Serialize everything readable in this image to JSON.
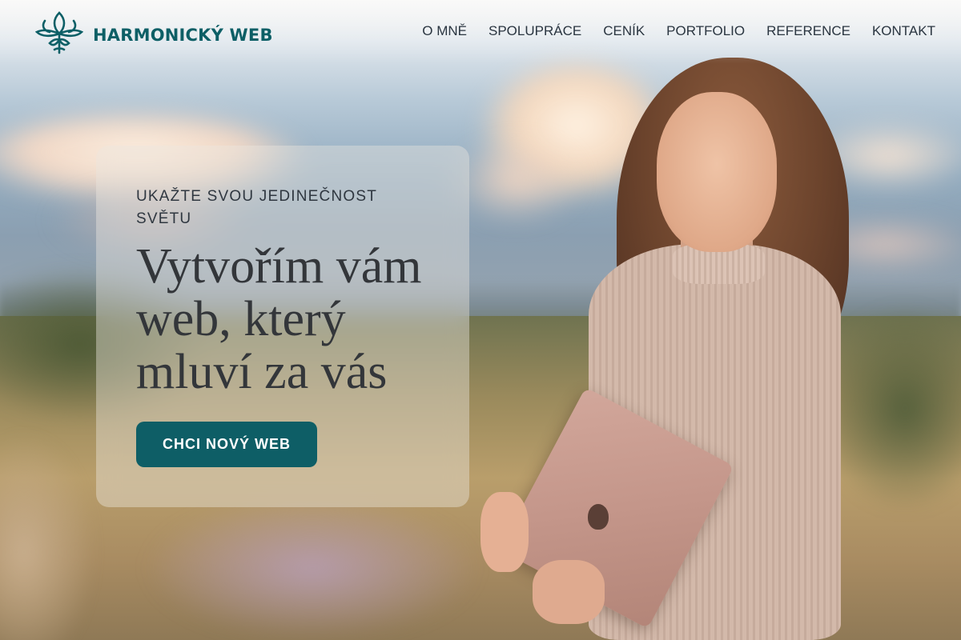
{
  "brand": {
    "name": "HARMONICKÝ WEB",
    "logo_icon": "lotus-ornament-icon",
    "color": "#0d5f66"
  },
  "nav": {
    "items": [
      {
        "label": "O MNĚ"
      },
      {
        "label": "SPOLUPRÁCE"
      },
      {
        "label": "CENÍK"
      },
      {
        "label": "PORTFOLIO"
      },
      {
        "label": "REFERENCE"
      },
      {
        "label": "KONTAKT"
      }
    ]
  },
  "hero": {
    "eyebrow": "UKAŽTE SVOU JEDINEČNOST SVĚTU",
    "headline": "Vytvořím vám web, který mluví za vás",
    "cta_label": "CHCI NOVÝ WEB",
    "cta_color": "#0e5e66"
  }
}
